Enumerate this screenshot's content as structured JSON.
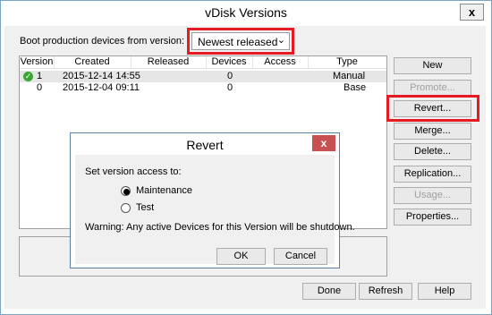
{
  "window": {
    "title": "vDisk Versions",
    "close": "x"
  },
  "boot": {
    "label": "Boot production devices from version:",
    "selected": "Newest released"
  },
  "table": {
    "columns": [
      "Version",
      "Created",
      "Released",
      "Devices",
      "Access",
      "Type"
    ],
    "rows": [
      {
        "version": "1",
        "created": "2015-12-14 14:55",
        "released": "",
        "devices": "0",
        "access": "",
        "type": "Manual"
      },
      {
        "version": "0",
        "created": "2015-12-04 09:11",
        "released": "",
        "devices": "0",
        "access": "",
        "type": "Base"
      }
    ]
  },
  "side_buttons": {
    "new": "New",
    "promote": "Promote...",
    "revert": "Revert...",
    "merge": "Merge...",
    "delete": "Delete...",
    "replication": "Replication...",
    "usage": "Usage...",
    "properties": "Properties..."
  },
  "bottom_buttons": {
    "done": "Done",
    "refresh": "Refresh",
    "help": "Help"
  },
  "dialog": {
    "title": "Revert",
    "close": "x",
    "prompt": "Set version access to:",
    "option_maintenance": "Maintenance",
    "option_test": "Test",
    "warning": "Warning: Any active Devices for this Version will be shutdown.",
    "ok": "OK",
    "cancel": "Cancel"
  },
  "colors": {
    "highlight": "#e41b23",
    "dialog_close": "#c75050",
    "check": "#3ba535"
  }
}
